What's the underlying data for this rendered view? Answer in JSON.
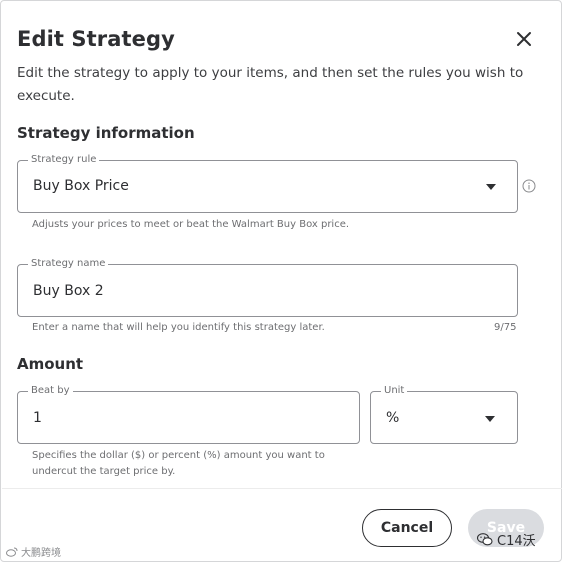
{
  "dialog": {
    "title": "Edit Strategy",
    "intro": "Edit the strategy to apply to your items, and then set the rules you wish to execute."
  },
  "strategy_information": {
    "heading": "Strategy information",
    "rule": {
      "label": "Strategy rule",
      "value": "Buy Box Price",
      "helper": "Adjusts your prices to meet or beat the Walmart Buy Box price.",
      "icon": "info-icon"
    },
    "name": {
      "label": "Strategy name",
      "value": "Buy Box 2",
      "helper": "Enter a name that will help you identify this strategy later.",
      "counter": "9/75"
    }
  },
  "amount": {
    "heading": "Amount",
    "beat_by": {
      "label": "Beat by",
      "value": "1",
      "helper": "Specifies the dollar ($) or percent (%) amount you want to undercut the target price by."
    },
    "unit": {
      "label": "Unit",
      "value": "%"
    }
  },
  "footer": {
    "cancel_label": "Cancel",
    "save_label": "Save"
  },
  "watermarks": {
    "left": "大鹏跨境",
    "right": "C14沃"
  }
}
